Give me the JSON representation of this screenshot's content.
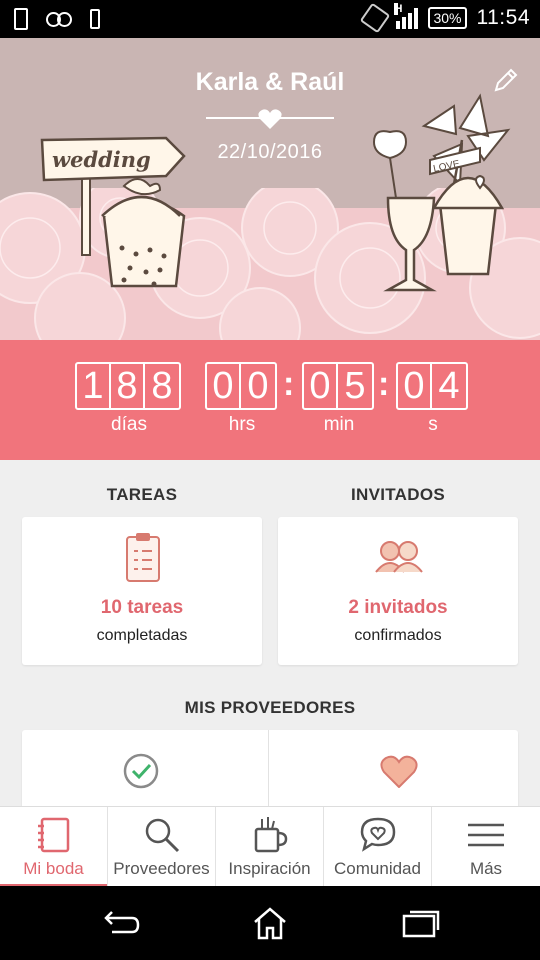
{
  "status_bar": {
    "battery": "30%",
    "network": "H",
    "time": "11:54"
  },
  "header": {
    "couple": "Karla & Raúl",
    "date": "22/10/2016",
    "sign_text": "wedding",
    "flag_text": "LOVE"
  },
  "countdown": {
    "days_digits": [
      "1",
      "8",
      "8"
    ],
    "hours_digits": [
      "0",
      "0"
    ],
    "minutes_digits": [
      "0",
      "5"
    ],
    "seconds_digits": [
      "0",
      "4"
    ],
    "separator": ":",
    "labels": {
      "days": "días",
      "hours": "hrs",
      "minutes": "min",
      "seconds": "s"
    }
  },
  "tasks": {
    "title": "TAREAS",
    "count": "10 tareas",
    "status": "completadas"
  },
  "guests": {
    "title": "INVITADOS",
    "count": "2 invitados",
    "status": "confirmados"
  },
  "vendors": {
    "title": "MIS PROVEEDORES"
  },
  "bottom_nav": {
    "items": [
      {
        "label": "Mi boda",
        "icon": "notebook-icon",
        "active": true
      },
      {
        "label": "Proveedores",
        "icon": "search-icon",
        "active": false
      },
      {
        "label": "Inspiración",
        "icon": "inspiration-icon",
        "active": false
      },
      {
        "label": "Comunidad",
        "icon": "chat-heart-icon",
        "active": false
      },
      {
        "label": "Más",
        "icon": "menu-icon",
        "active": false
      }
    ]
  },
  "colors": {
    "accent": "#f1747c",
    "accent_text": "#e0676f",
    "header_bg": "#c9b5b3",
    "check_green": "#3fb36b",
    "heart_peach": "#f3b29b"
  }
}
